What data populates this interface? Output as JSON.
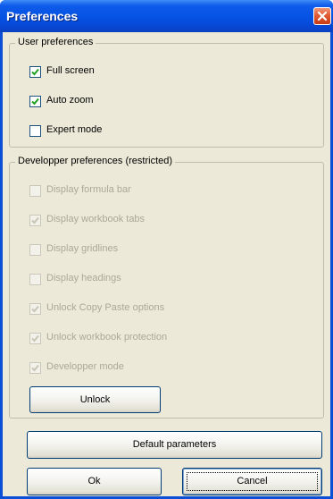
{
  "window": {
    "title": "Preferences"
  },
  "user_prefs": {
    "legend": "User preferences",
    "items": [
      {
        "label": "Full screen",
        "checked": true,
        "enabled": true
      },
      {
        "label": "Auto zoom",
        "checked": true,
        "enabled": true
      },
      {
        "label": "Expert mode",
        "checked": false,
        "enabled": true
      }
    ]
  },
  "dev_prefs": {
    "legend": "Developper preferences (restricted)",
    "items": [
      {
        "label": "Display formula bar",
        "checked": false,
        "enabled": false
      },
      {
        "label": "Display workbook tabs",
        "checked": true,
        "enabled": false
      },
      {
        "label": "Display gridlines",
        "checked": false,
        "enabled": false
      },
      {
        "label": "Display headings",
        "checked": false,
        "enabled": false
      },
      {
        "label": "Unlock Copy Paste options",
        "checked": true,
        "enabled": false
      },
      {
        "label": "Unlock workbook protection",
        "checked": true,
        "enabled": false
      },
      {
        "label": "Developper mode",
        "checked": true,
        "enabled": false
      }
    ],
    "unlock_label": "Unlock"
  },
  "buttons": {
    "default_label": "Default parameters",
    "ok_label": "Ok",
    "cancel_label": "Cancel"
  },
  "colors": {
    "title_bar": "#0654e4",
    "dialog_face": "#ece9d8",
    "check_enabled": "#21a121",
    "check_disabled": "#c8c5b5",
    "close_button": "#e05a33"
  }
}
